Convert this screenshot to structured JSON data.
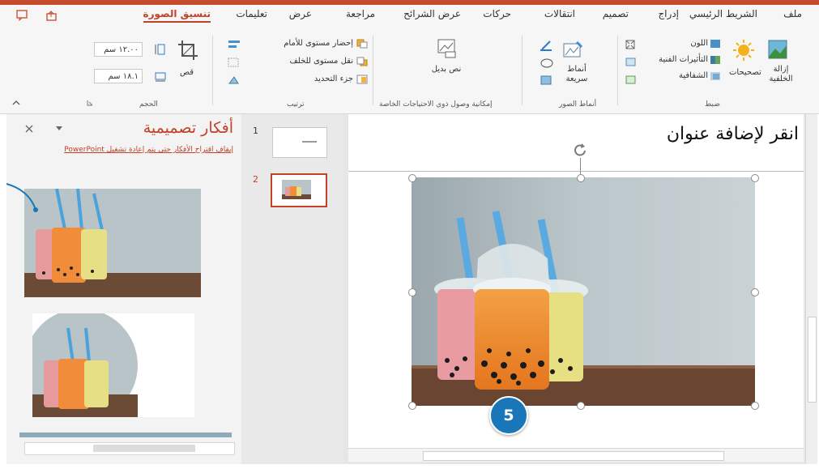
{
  "ribbon": {
    "tabs": [
      "ملف",
      "الشريط الرئيسي",
      "إدراج",
      "تصميم",
      "انتقالات",
      "حركات",
      "عرض الشرائح",
      "مراجعة",
      "عرض",
      "تعليمات",
      "تنسيق الصورة"
    ],
    "remove_background": "إزالة الخلفية",
    "corrections": "تصحيحات",
    "color": "اللون",
    "artistic_effects": "التأثيرات الفنية",
    "transparency": "الشفافية",
    "adjust_group": "ضبط",
    "quick_styles": "أنماط سريعة",
    "picture_styles_group": "أنماط الصور",
    "alt_text": "نص بديل",
    "accessibility_group": "إمكانية وصول ذوي الاحتياجات الخاصة",
    "bring_forward": "إحضار مستوى للأمام",
    "send_backward": "نقل مستوى للخلف",
    "selection_pane": "جزء التحديد",
    "arrange_group": "ترتيب",
    "crop": "قص",
    "height_value": "١٢.٠٠ سم",
    "width_value": "١٨.١ سم",
    "size_group": "الحجم"
  },
  "design_pane": {
    "title": "أفكار تصميمية",
    "link_text": "إيقاف اقتراح الأفكار حتى يتم إعادة تشغيل PowerPoint"
  },
  "slides": [
    {
      "number": "1"
    },
    {
      "number": "2"
    }
  ],
  "slide": {
    "title_placeholder": "انقر لإضافة عنوان"
  },
  "callout": {
    "number": "5"
  },
  "colors": {
    "accent": "#c24129",
    "badge": "#1976b8"
  }
}
